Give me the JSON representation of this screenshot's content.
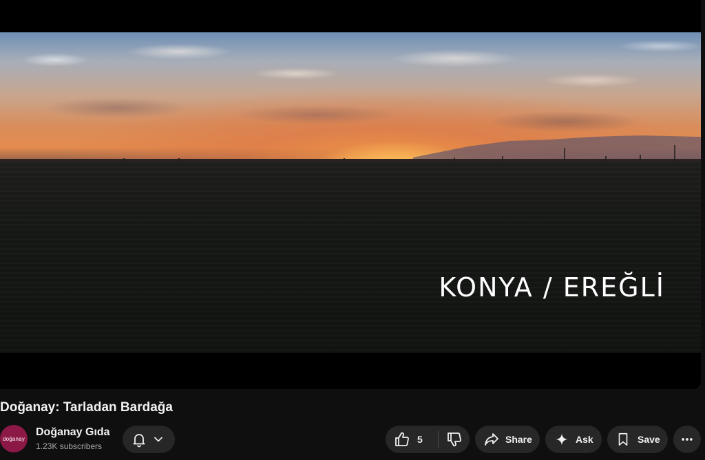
{
  "video": {
    "overlay_text": "KONYA / EREĞLİ"
  },
  "meta": {
    "title": "Doğanay: Tarladan Bardağa"
  },
  "channel": {
    "name": "Doğanay Gıda",
    "subscribers": "1.23K subscribers",
    "avatar_text": "doğanay",
    "avatar_color": "#8c1848"
  },
  "actions": {
    "like_count": "5",
    "share_label": "Share",
    "ask_label": "Ask",
    "save_label": "Save"
  },
  "icons": {
    "bell": "bell-icon",
    "chevron": "chevron-down-icon",
    "like": "thumbs-up-icon",
    "dislike": "thumbs-down-icon",
    "share": "share-arrow-icon",
    "ask": "sparkle-icon",
    "save": "bookmark-icon",
    "more": "more-horizontal-icon"
  },
  "colors": {
    "background": "#0f0f0f",
    "pill": "#272727",
    "text": "#f1f1f1",
    "secondary_text": "#aaaaaa"
  }
}
